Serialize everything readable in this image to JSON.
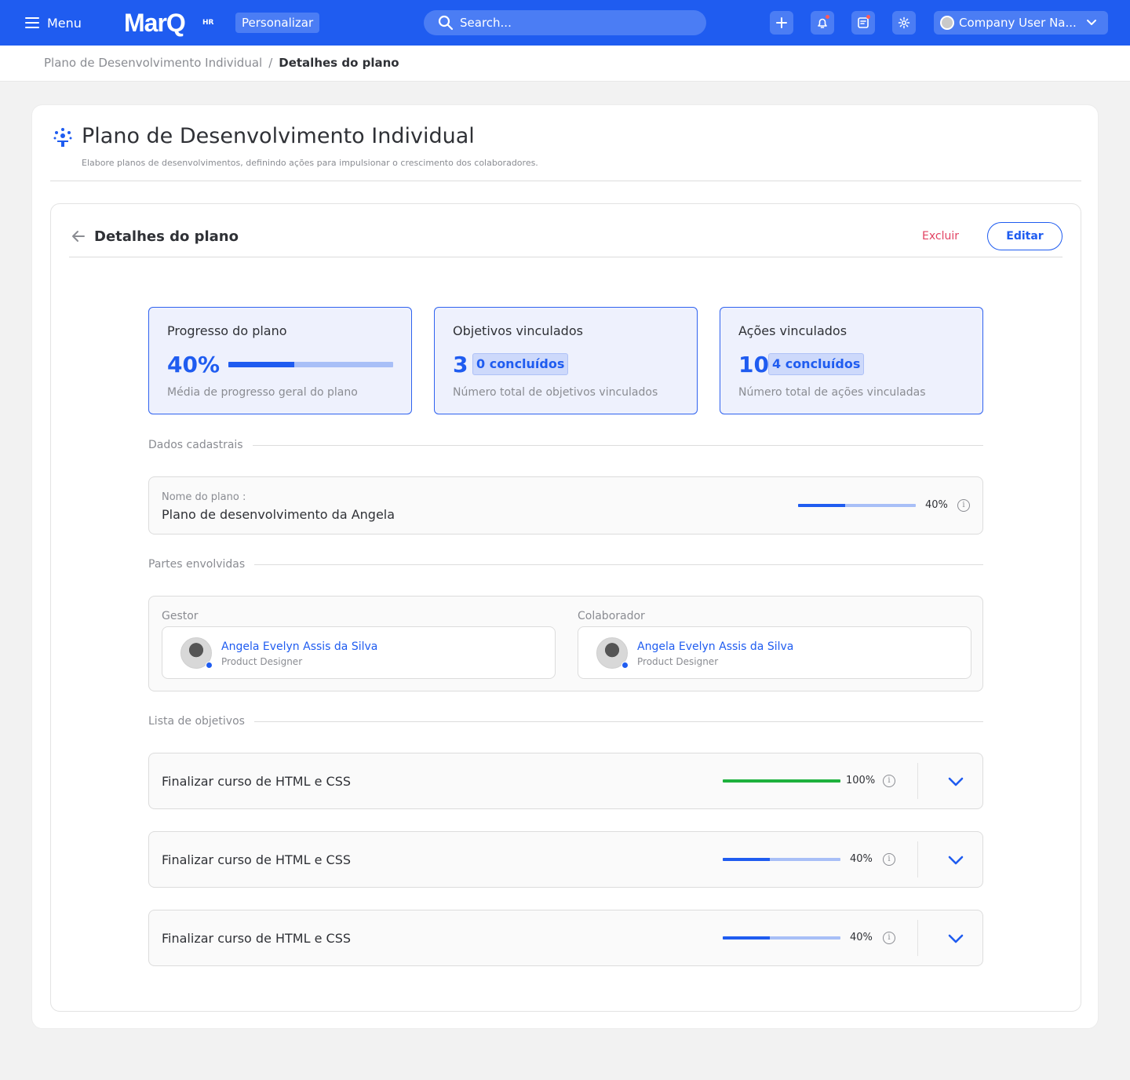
{
  "topbar": {
    "menu_label": "Menu",
    "logo_text": "MarQ",
    "logo_sub": "HR",
    "personalizar_label": "Personalizar",
    "search_placeholder": "Search...",
    "user_name": "Company User Na...",
    "brand_color": "#1f5cf0"
  },
  "breadcrumb": {
    "parent": "Plano de Desenvolvimento Individual",
    "separator": "/",
    "current": "Detalhes do plano"
  },
  "page": {
    "title": "Plano de Desenvolvimento Individual",
    "subtitle": "Elabore planos de desenvolvimentos, definindo ações para impulsionar o crescimento dos colaboradores."
  },
  "details": {
    "title": "Detalhes do plano",
    "delete_label": "Excluir",
    "edit_label": "Editar"
  },
  "stats": {
    "progress": {
      "label": "Progresso do plano",
      "value": "40%",
      "fraction": 0.4,
      "description": "Média de progresso geral do plano"
    },
    "objectives": {
      "label": "Objetivos vinculados",
      "value": "3",
      "chip": "0 concluídos",
      "description": "Número total de objetivos vinculados"
    },
    "actions": {
      "label": "Ações vinculados",
      "value": "10",
      "chip": "4 concluídos",
      "description": "Número total de ações vinculadas"
    }
  },
  "registration": {
    "section_label": "Dados cadastrais",
    "plan_label": "Nome do plano :",
    "plan_name": "Plano de desenvolvimento da Angela",
    "progress_text": "40%",
    "progress_fraction": 0.4
  },
  "parties": {
    "section_label": "Partes envolvidas",
    "manager": {
      "label": "Gestor",
      "name": "Angela Evelyn Assis da Silva",
      "role": "Product Designer"
    },
    "collaborator": {
      "label": "Colaborador",
      "name": "Angela Evelyn Assis da Silva",
      "role": "Product Designer"
    }
  },
  "objectives": {
    "section_label": "Lista de objetivos",
    "items": [
      {
        "title": "Finalizar curso de HTML e CSS",
        "progress_text": "100%",
        "fraction": 1.0,
        "status": "complete"
      },
      {
        "title": "Finalizar curso de HTML e CSS",
        "progress_text": "40%",
        "fraction": 0.4,
        "status": "in-progress"
      },
      {
        "title": "Finalizar curso de HTML e CSS",
        "progress_text": "40%",
        "fraction": 0.4,
        "status": "in-progress"
      }
    ]
  },
  "icons": {
    "menu": "hamburger-icon",
    "search": "search-icon",
    "add": "plus-icon",
    "notifications": "bell-icon",
    "notes": "note-icon",
    "settings": "gear-icon",
    "user_chevron": "chevron-down-icon",
    "back": "arrow-left-icon",
    "info": "info-icon",
    "expand": "chevron-down-icon",
    "page": "people-growth-icon"
  },
  "colors": {
    "primary": "#1f5cf0",
    "progress_track": "#a8bff7",
    "complete": "#1eb13d",
    "danger": "#e24262",
    "stat_bg": "#eef1fd"
  }
}
